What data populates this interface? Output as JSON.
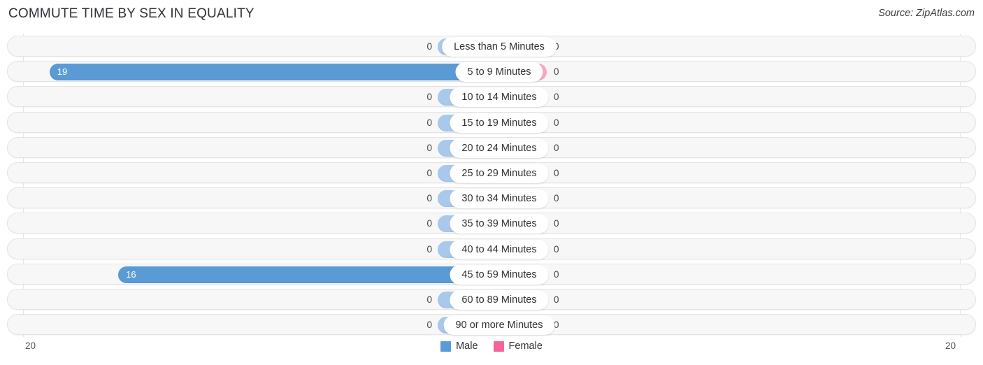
{
  "header": {
    "title": "COMMUTE TIME BY SEX IN EQUALITY",
    "source": "Source: ZipAtlas.com"
  },
  "axis": {
    "left_label": "20",
    "right_label": "20",
    "max": 20
  },
  "legend": {
    "items": [
      {
        "label": "Male",
        "color": "#5b9bd5",
        "icon": "male-swatch-icon"
      },
      {
        "label": "Female",
        "color": "#f4649a",
        "icon": "female-swatch-icon"
      }
    ]
  },
  "colors": {
    "male_bar": "#5b9bd5",
    "male_bar_zero": "#a9c9ec",
    "female_bar": "#f4649a",
    "female_bar_zero": "#f9a7c4",
    "row_background": "#f7f7f7",
    "row_border": "#e3e3e3",
    "gridline": "#e6e6e6"
  },
  "chart_data": {
    "type": "bar",
    "title": "COMMUTE TIME BY SEX IN EQUALITY",
    "subtitle": "Source: ZipAtlas.com",
    "orientation": "horizontal-diverging",
    "xlabel": "",
    "ylabel": "",
    "xlim": [
      20,
      20
    ],
    "grid": true,
    "legend_position": "bottom-center",
    "categories": [
      "Less than 5 Minutes",
      "5 to 9 Minutes",
      "10 to 14 Minutes",
      "15 to 19 Minutes",
      "20 to 24 Minutes",
      "25 to 29 Minutes",
      "30 to 34 Minutes",
      "35 to 39 Minutes",
      "40 to 44 Minutes",
      "45 to 59 Minutes",
      "60 to 89 Minutes",
      "90 or more Minutes"
    ],
    "series": [
      {
        "name": "Male",
        "values": [
          0,
          19,
          0,
          0,
          0,
          0,
          0,
          0,
          0,
          16,
          0,
          0
        ]
      },
      {
        "name": "Female",
        "values": [
          0,
          0,
          0,
          0,
          0,
          0,
          0,
          0,
          0,
          0,
          0,
          0
        ]
      }
    ]
  },
  "rows": [
    {
      "label": "Less than 5 Minutes",
      "male": "0",
      "female": "0"
    },
    {
      "label": "5 to 9 Minutes",
      "male": "19",
      "female": "0"
    },
    {
      "label": "10 to 14 Minutes",
      "male": "0",
      "female": "0"
    },
    {
      "label": "15 to 19 Minutes",
      "male": "0",
      "female": "0"
    },
    {
      "label": "20 to 24 Minutes",
      "male": "0",
      "female": "0"
    },
    {
      "label": "25 to 29 Minutes",
      "male": "0",
      "female": "0"
    },
    {
      "label": "30 to 34 Minutes",
      "male": "0",
      "female": "0"
    },
    {
      "label": "35 to 39 Minutes",
      "male": "0",
      "female": "0"
    },
    {
      "label": "40 to 44 Minutes",
      "male": "0",
      "female": "0"
    },
    {
      "label": "45 to 59 Minutes",
      "male": "16",
      "female": "0"
    },
    {
      "label": "60 to 89 Minutes",
      "male": "0",
      "female": "0"
    },
    {
      "label": "90 or more Minutes",
      "male": "0",
      "female": "0"
    }
  ]
}
